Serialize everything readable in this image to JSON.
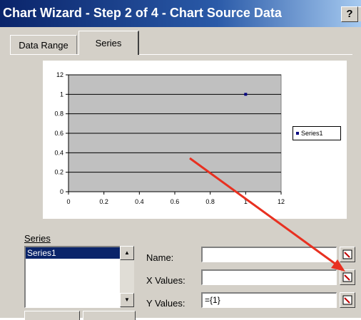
{
  "window": {
    "title": "Chart Wizard - Step 2 of 4 - Chart Source Data",
    "help_label": "?"
  },
  "tabs": [
    {
      "label": "Data Range"
    },
    {
      "label": "Series"
    }
  ],
  "chart_data": {
    "type": "scatter",
    "series": [
      {
        "name": "Series1",
        "x": [
          1
        ],
        "y": [
          1
        ]
      }
    ],
    "x_ticks": [
      "0",
      "0.2",
      "0.4",
      "0.6",
      "0.8",
      "1",
      "12"
    ],
    "y_ticks": [
      "0",
      "0.2",
      "0.4",
      "0.6",
      "0.8",
      "1",
      "12"
    ],
    "xlim": [
      0,
      1.2
    ],
    "ylim": [
      0,
      1.2
    ],
    "grid": true,
    "legend_position": "right",
    "colors": {
      "plot_bg": "#c0c0c0",
      "marker": "#000080"
    }
  },
  "series_panel": {
    "label": "Series",
    "items": [
      "Series1"
    ],
    "name_label": "Name:",
    "name_value": "",
    "x_label": "X Values:",
    "x_value": "",
    "y_label": "Y Values:",
    "y_value": "={1}"
  },
  "annotation": {
    "arrow_color": "#e83020"
  }
}
